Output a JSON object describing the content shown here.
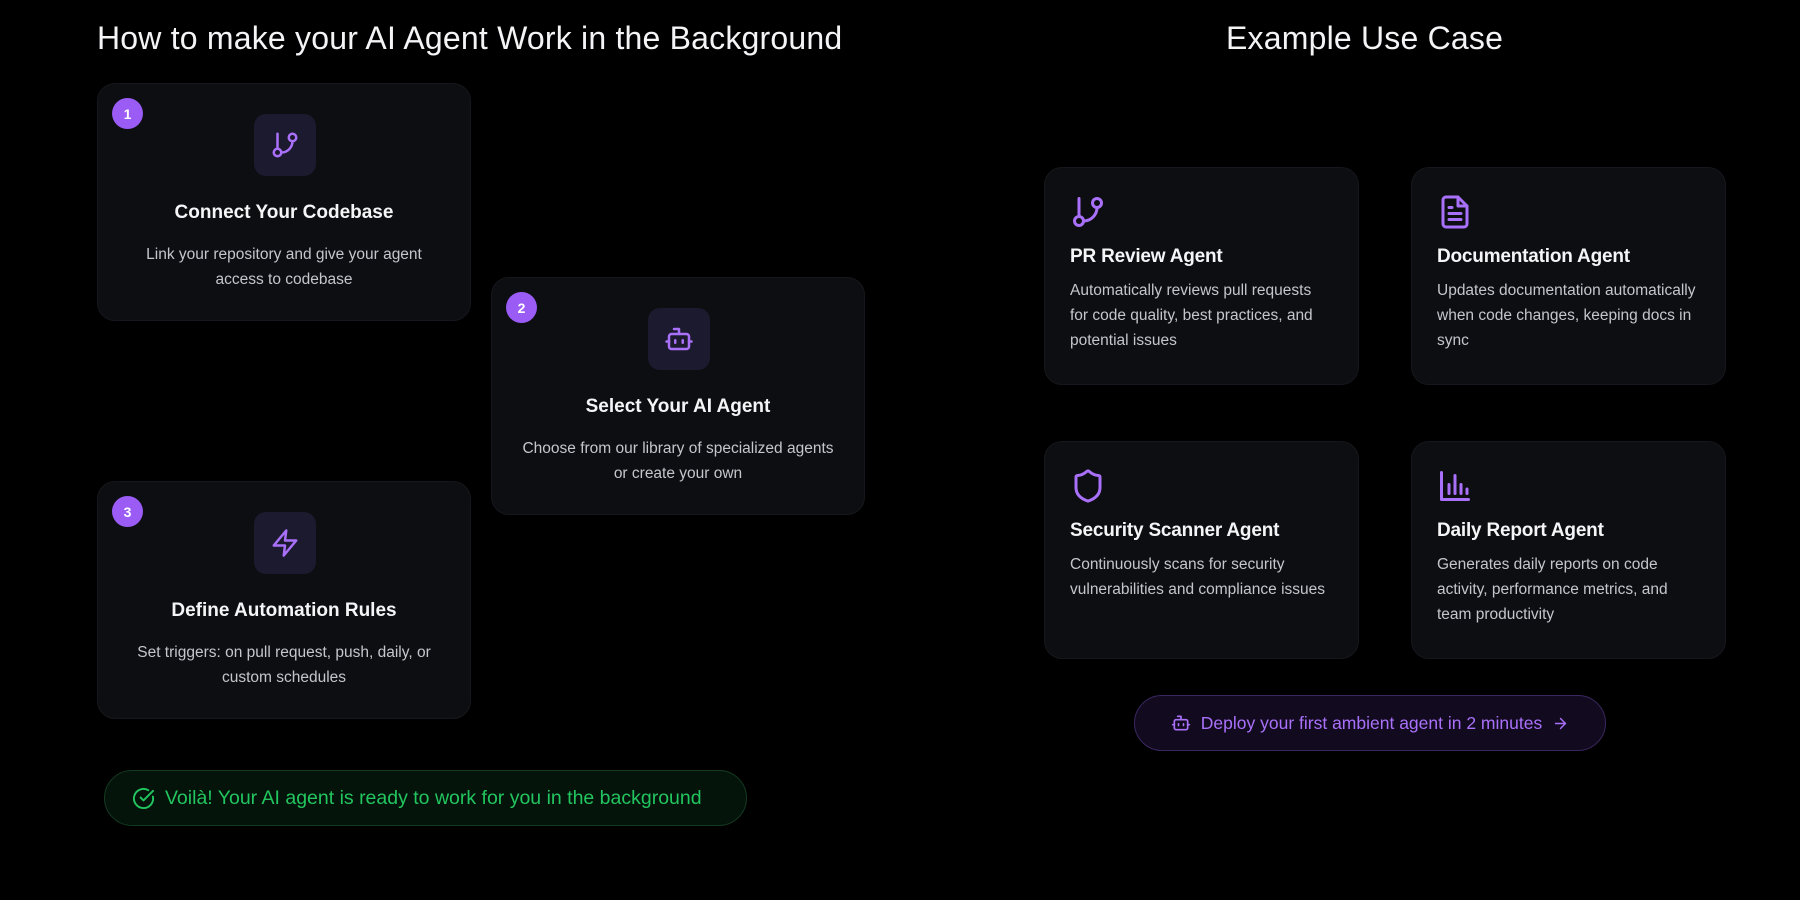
{
  "colors": {
    "background": "#000000",
    "card": "#0d0e12",
    "accent_purple": "#9b5cf6",
    "success_green": "#22c55e"
  },
  "left_section": {
    "heading": "How to make your AI Agent Work in the Background",
    "steps": [
      {
        "number": "1",
        "icon": "git-branch-icon",
        "title": "Connect Your Codebase",
        "description": "Link your repository and give your agent access to codebase"
      },
      {
        "number": "2",
        "icon": "bot-icon",
        "title": "Select Your AI Agent",
        "description": "Choose from our library of specialized agents or create your own"
      },
      {
        "number": "3",
        "icon": "lightning-icon",
        "title": "Define Automation Rules",
        "description": "Set triggers: on pull request, push, daily, or custom schedules"
      }
    ],
    "success_message": "Voilà! Your AI agent is ready to work for you in the background"
  },
  "right_section": {
    "heading": "Example Use Case",
    "use_cases": [
      {
        "icon": "git-branch-icon",
        "title": "PR Review Agent",
        "description": "Automatically reviews pull requests for code quality, best practices, and potential issues"
      },
      {
        "icon": "document-icon",
        "title": "Documentation Agent",
        "description": "Updates documentation automatically when code changes, keeping docs in sync"
      },
      {
        "icon": "shield-icon",
        "title": "Security Scanner Agent",
        "description": "Continuously scans for security vulnerabilities and compliance issues"
      },
      {
        "icon": "bar-chart-icon",
        "title": "Daily Report Agent",
        "description": "Generates daily reports on code activity, performance metrics, and team productivity"
      }
    ],
    "cta_label": "Deploy your first ambient agent in 2 minutes"
  }
}
